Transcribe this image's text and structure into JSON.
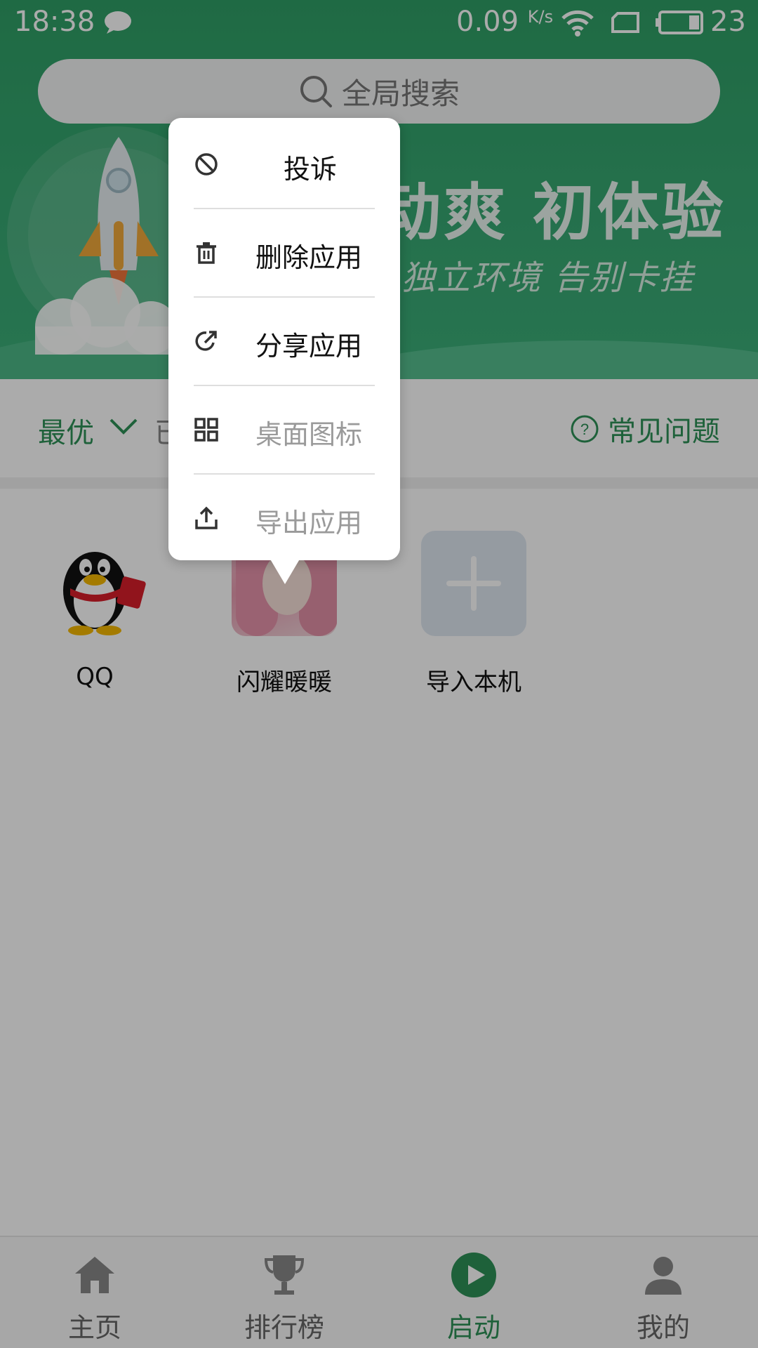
{
  "status_bar": {
    "time": "18:38",
    "net_speed": "0.09",
    "net_unit": "K/s",
    "battery_level": "23"
  },
  "search": {
    "placeholder": "全局搜索"
  },
  "banner": {
    "headline": "动爽  初体验",
    "subline": "独立环境  告别卡挂"
  },
  "filter": {
    "sort_label": "最优",
    "partial_tab": "已",
    "faq_label": "常见问题"
  },
  "apps": [
    {
      "name": "QQ",
      "icon": "qq-penguin-icon"
    },
    {
      "name": "闪耀暖暖",
      "icon": "game-girl-icon"
    },
    {
      "name": "导入本机",
      "icon": "plus-icon"
    }
  ],
  "context_menu": {
    "items": [
      {
        "label": "投诉",
        "icon": "ban-icon",
        "enabled": true
      },
      {
        "label": "删除应用",
        "icon": "trash-icon",
        "enabled": true
      },
      {
        "label": "分享应用",
        "icon": "share-icon",
        "enabled": true
      },
      {
        "label": "桌面图标",
        "icon": "grid-icon",
        "enabled": false
      },
      {
        "label": "导出应用",
        "icon": "export-icon",
        "enabled": false
      }
    ]
  },
  "bottom_nav": {
    "items": [
      {
        "label": "主页",
        "icon": "home-icon",
        "active": false
      },
      {
        "label": "排行榜",
        "icon": "trophy-icon",
        "active": false
      },
      {
        "label": "启动",
        "icon": "play-icon",
        "active": true
      },
      {
        "label": "我的",
        "icon": "user-icon",
        "active": false
      }
    ]
  },
  "colors": {
    "brand_green": "#2e9157",
    "banner_green": "#37a872",
    "disabled_text": "#9a9a9a"
  }
}
